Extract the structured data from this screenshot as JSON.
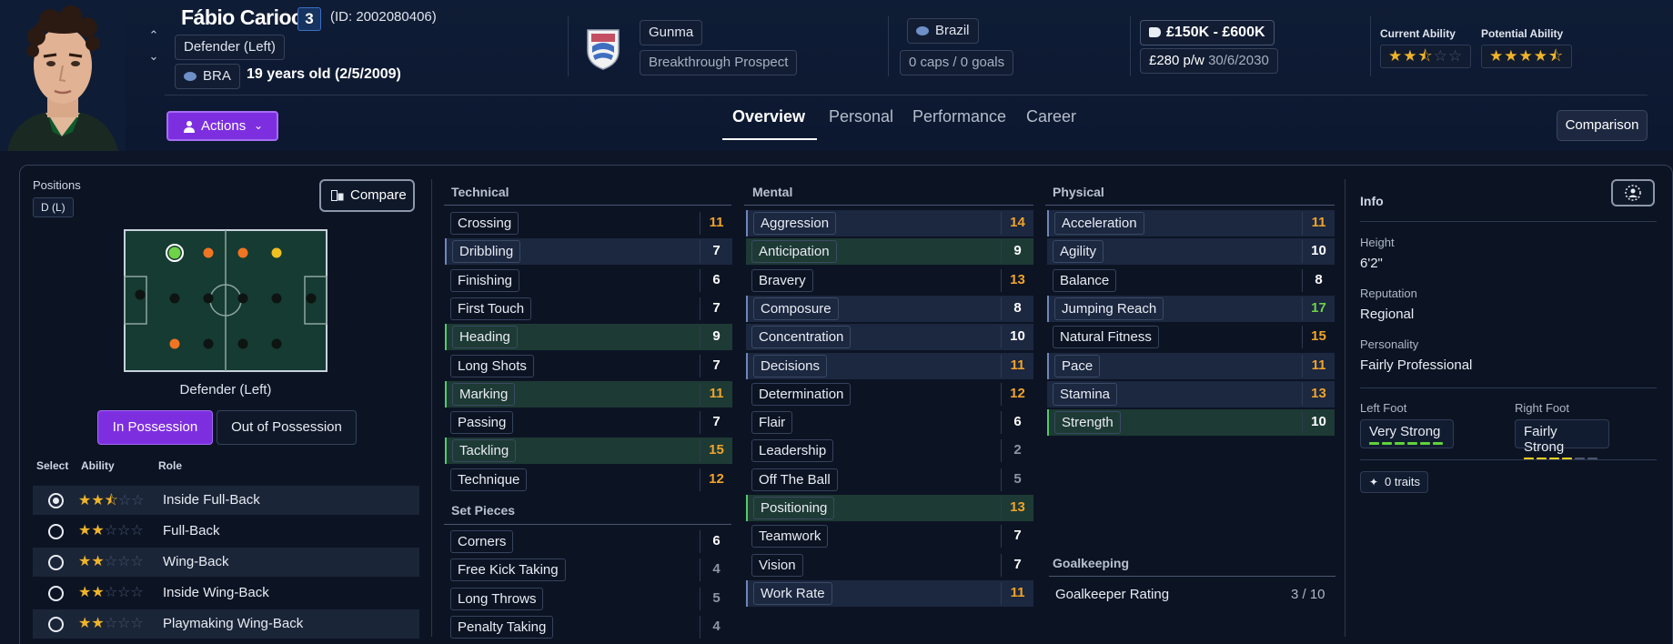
{
  "player": {
    "name": "Fábio Carioca",
    "squad_number": "3",
    "id": "(ID: 2002080406)",
    "position": "Defender (Left)",
    "nationality_code": "BRA",
    "age": "19 years old (2/5/2009)"
  },
  "club": {
    "name": "Gunma",
    "status": "Breakthrough Prospect"
  },
  "international": {
    "country": "Brazil",
    "caps": "0 caps / 0 goals"
  },
  "contract": {
    "value": "£150K - £600K",
    "wage": "£280 p/w",
    "expires": "30/6/2030"
  },
  "ability": {
    "current_label": "Current Ability",
    "current_stars": 2.5,
    "potential_label": "Potential Ability",
    "potential_stars": 4.5
  },
  "header": {
    "actions_label": "Actions",
    "tabs": [
      "Overview",
      "Personal",
      "Performance",
      "Career"
    ],
    "comparison_label": "Comparison"
  },
  "positions": {
    "label": "Positions",
    "chip": "D (L)",
    "compare_label": "Compare",
    "caption": "Defender (Left)",
    "in_possession": "In Possession",
    "out_possession": "Out of Possession",
    "col_select": "Select",
    "col_ability": "Ability",
    "col_role": "Role",
    "roles": [
      {
        "name": "Inside Full-Back",
        "stars": 2.5,
        "selected": true
      },
      {
        "name": "Full-Back",
        "stars": 2,
        "selected": false
      },
      {
        "name": "Wing-Back",
        "stars": 2,
        "selected": false
      },
      {
        "name": "Inside Wing-Back",
        "stars": 2,
        "selected": false
      },
      {
        "name": "Playmaking Wing-Back",
        "stars": 2,
        "selected": false
      }
    ]
  },
  "technical": {
    "title": "Technical",
    "attrs": [
      {
        "name": "Crossing",
        "value": "11"
      },
      {
        "name": "Dribbling",
        "value": "7"
      },
      {
        "name": "Finishing",
        "value": "6"
      },
      {
        "name": "First Touch",
        "value": "7"
      },
      {
        "name": "Heading",
        "value": "9"
      },
      {
        "name": "Long Shots",
        "value": "7"
      },
      {
        "name": "Marking",
        "value": "11"
      },
      {
        "name": "Passing",
        "value": "7"
      },
      {
        "name": "Tackling",
        "value": "15"
      },
      {
        "name": "Technique",
        "value": "12"
      }
    ]
  },
  "set_pieces": {
    "title": "Set Pieces",
    "attrs": [
      {
        "name": "Corners",
        "value": "6"
      },
      {
        "name": "Free Kick Taking",
        "value": "4"
      },
      {
        "name": "Long Throws",
        "value": "5"
      },
      {
        "name": "Penalty Taking",
        "value": "4"
      }
    ]
  },
  "mental": {
    "title": "Mental",
    "attrs": [
      {
        "name": "Aggression",
        "value": "14"
      },
      {
        "name": "Anticipation",
        "value": "9"
      },
      {
        "name": "Bravery",
        "value": "13"
      },
      {
        "name": "Composure",
        "value": "8"
      },
      {
        "name": "Concentration",
        "value": "10"
      },
      {
        "name": "Decisions",
        "value": "11"
      },
      {
        "name": "Determination",
        "value": "12"
      },
      {
        "name": "Flair",
        "value": "6"
      },
      {
        "name": "Leadership",
        "value": "2"
      },
      {
        "name": "Off The Ball",
        "value": "5"
      },
      {
        "name": "Positioning",
        "value": "13"
      },
      {
        "name": "Teamwork",
        "value": "7"
      },
      {
        "name": "Vision",
        "value": "7"
      },
      {
        "name": "Work Rate",
        "value": "11"
      }
    ]
  },
  "physical": {
    "title": "Physical",
    "attrs": [
      {
        "name": "Acceleration",
        "value": "11"
      },
      {
        "name": "Agility",
        "value": "10"
      },
      {
        "name": "Balance",
        "value": "8"
      },
      {
        "name": "Jumping Reach",
        "value": "17"
      },
      {
        "name": "Natural Fitness",
        "value": "15"
      },
      {
        "name": "Pace",
        "value": "11"
      },
      {
        "name": "Stamina",
        "value": "13"
      },
      {
        "name": "Strength",
        "value": "10"
      }
    ]
  },
  "goalkeeping": {
    "title": "Goalkeeping",
    "rating_label": "Goalkeeper Rating",
    "rating_value": "3 / 10"
  },
  "info": {
    "title": "Info",
    "height_label": "Height",
    "height": "6'2\"",
    "reputation_label": "Reputation",
    "reputation": "Regional",
    "personality_label": "Personality",
    "personality": "Fairly Professional",
    "left_foot_label": "Left Foot",
    "left_foot": "Very Strong",
    "left_foot_level": 6,
    "right_foot_label": "Right Foot",
    "right_foot": "Fairly Strong",
    "right_foot_level": 4,
    "traits": "0 traits"
  },
  "colors": {
    "accent": "#7d2fe0",
    "orange": "#f0a32a",
    "green": "#6fd247",
    "white": "#ffffff",
    "dim": "#8c95a6"
  }
}
